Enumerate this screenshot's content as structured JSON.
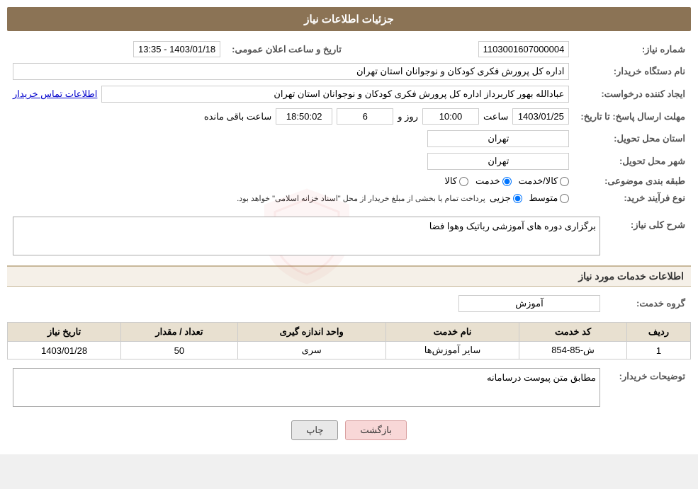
{
  "header": {
    "title": "جزئیات اطلاعات نیاز"
  },
  "fields": {
    "need_number_label": "شماره نیاز:",
    "need_number_value": "1103001607000004",
    "buyer_org_label": "نام دستگاه خریدار:",
    "buyer_org_value": "اداره کل پرورش فکری کودکان و نوجوانان استان تهران",
    "requester_label": "ایجاد کننده درخواست:",
    "requester_value": "عبادالله بهور کاربرداز اداره کل پرورش فکری کودکان و نوجوانان استان تهران",
    "contact_link": "اطلاعات تماس خریدار",
    "announcement_datetime_label": "تاریخ و ساعت اعلان عمومی:",
    "announcement_datetime_value": "1403/01/18 - 13:35",
    "response_deadline_label": "مهلت ارسال پاسخ: تا تاریخ:",
    "deadline_date": "1403/01/25",
    "deadline_time_label": "ساعت",
    "deadline_time": "10:00",
    "deadline_days_label": "روز و",
    "deadline_days": "6",
    "deadline_remaining_label": "ساعت باقی مانده",
    "deadline_remaining": "18:50:02",
    "delivery_province_label": "استان محل تحویل:",
    "delivery_province_value": "تهران",
    "delivery_city_label": "شهر محل تحویل:",
    "delivery_city_value": "تهران",
    "subject_label": "طبقه بندی موضوعی:",
    "subject_options": [
      "کالا",
      "خدمت",
      "کالا/خدمت"
    ],
    "subject_selected": "خدمت",
    "purchase_type_label": "نوع فرآیند خرید:",
    "purchase_type_options": [
      "جزیی",
      "متوسط"
    ],
    "purchase_type_note": "پرداخت تمام یا بخشی از مبلغ خریدار از محل \"اسناد خزانه اسلامی\" خواهد بود.",
    "general_description_section": "شرح کلی نیاز:",
    "general_description_value": "برگزاری دوره های آموزشی رباتیک  وهوا فضا",
    "services_section": "اطلاعات خدمات مورد نیاز",
    "service_group_label": "گروه خدمت:",
    "service_group_value": "آموزش",
    "table_headers": {
      "row_num": "ردیف",
      "service_code": "کد خدمت",
      "service_name": "نام خدمت",
      "unit": "واحد اندازه گیری",
      "quantity": "تعداد / مقدار",
      "date": "تاریخ نیاز"
    },
    "table_rows": [
      {
        "row_num": "1",
        "service_code": "ش-85-854",
        "service_name": "سایر آموزش‌ها",
        "unit": "سری",
        "quantity": "50",
        "date": "1403/01/28"
      }
    ],
    "buyer_desc_label": "توضیحات خریدار:",
    "buyer_desc_value": "مطابق متن پیوست درسامانه"
  },
  "buttons": {
    "print": "چاپ",
    "back": "بازگشت"
  }
}
